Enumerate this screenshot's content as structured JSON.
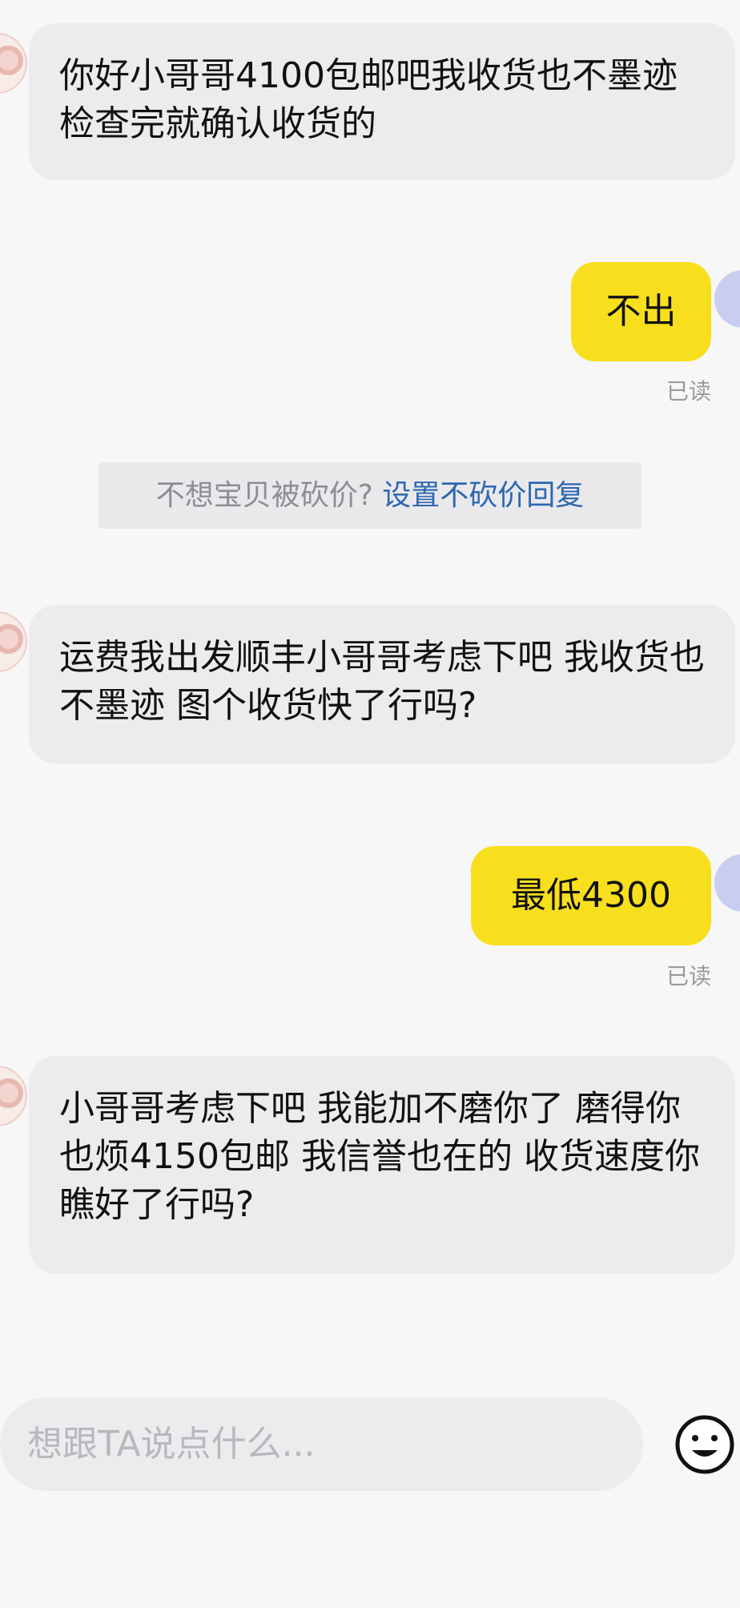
{
  "messages": [
    {
      "side": "in",
      "text": "你好小哥哥4100包邮吧我收货也不墨迹检查完就确认收货的"
    },
    {
      "side": "out",
      "text": "不出",
      "status": "已读"
    },
    {
      "side": "in",
      "text": "运费我出发顺丰小哥哥考虑下吧 我收货也不墨迹 图个收货快了行吗?"
    },
    {
      "side": "out",
      "text": "最低4300",
      "status": "已读"
    },
    {
      "side": "in",
      "text": "小哥哥考虑下吧 我能加不磨你了 磨得你也烦4150包邮 我信誉也在的 收货速度你瞧好了行吗?"
    }
  ],
  "notice": {
    "prefix": "不想宝贝被砍价?",
    "link": "设置不砍价回复"
  },
  "composer": {
    "placeholder": "想跟TA说点什么...",
    "emoji_icon": "smiley-face-icon"
  }
}
